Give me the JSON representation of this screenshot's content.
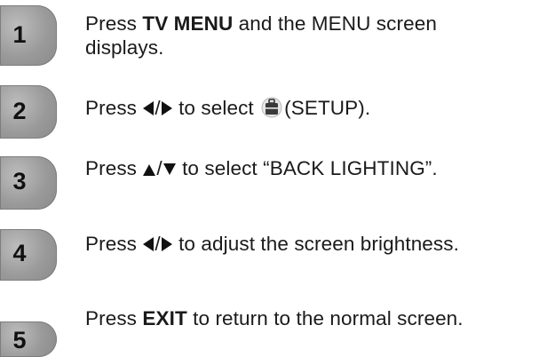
{
  "steps": [
    {
      "number": "1",
      "parts": {
        "a": "Press ",
        "b": "TV MENU",
        "c": " and the MENU screen",
        "line2": "displays."
      }
    },
    {
      "number": "2",
      "parts": {
        "a": "Press ",
        "slash": "/",
        "c": " to select ",
        "d": "(SETUP)."
      }
    },
    {
      "number": "3",
      "parts": {
        "a": "Press ",
        "slash": "/",
        "c": " to select “BACK LIGHTING”."
      }
    },
    {
      "number": "4",
      "parts": {
        "a": "Press ",
        "slash": "/",
        "c": " to adjust the screen brightness."
      }
    },
    {
      "number": "5",
      "parts": {
        "a": "Press ",
        "b": "EXIT",
        "c": " to return to the normal screen."
      }
    }
  ],
  "icons": {
    "left_arrow": "left-triangle-icon",
    "right_arrow": "right-triangle-icon",
    "up_arrow": "up-triangle-icon",
    "down_arrow": "down-triangle-icon",
    "setup": "setup-toolbox-icon"
  }
}
